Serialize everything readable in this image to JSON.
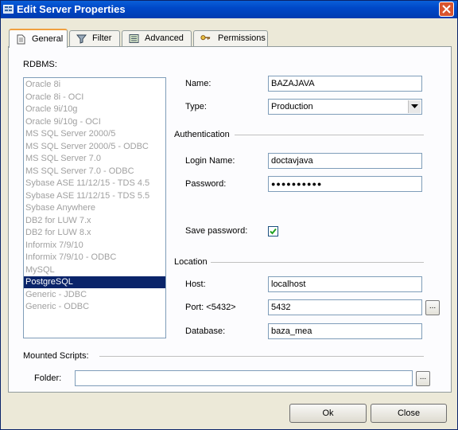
{
  "window": {
    "title": "Edit Server Properties"
  },
  "tabs": [
    {
      "label": "General",
      "icon": "page-icon",
      "active": true
    },
    {
      "label": "Filter",
      "icon": "filter-icon",
      "active": false
    },
    {
      "label": "Advanced",
      "icon": "advanced-icon",
      "active": false
    },
    {
      "label": "Permissions",
      "icon": "keys-icon",
      "active": false
    }
  ],
  "rdbms": {
    "label": "RDBMS:",
    "items": [
      "Oracle 8i",
      "Oracle 8i - OCI",
      "Oracle 9i/10g",
      "Oracle 9i/10g - OCI",
      "MS SQL Server 2000/5",
      "MS SQL Server 2000/5 - ODBC",
      "MS SQL Server 7.0",
      "MS SQL Server 7.0 - ODBC",
      "Sybase ASE 11/12/15 - TDS 4.5",
      "Sybase ASE 11/12/15 - TDS 5.5",
      "Sybase Anywhere",
      "DB2 for LUW 7.x",
      "DB2 for LUW 8.x",
      "Informix 7/9/10",
      "Informix 7/9/10 - ODBC",
      "MySQL",
      "PostgreSQL",
      "Generic - JDBC",
      "Generic - ODBC"
    ],
    "selected": "PostgreSQL"
  },
  "form": {
    "name_label": "Name:",
    "name_value": "BAZAJAVA",
    "type_label": "Type:",
    "type_value": "Production",
    "auth_section": "Authentication",
    "login_label": "Login Name:",
    "login_value": "doctavjava",
    "password_label": "Password:",
    "password_value": "●●●●●●●●●●",
    "save_password_label": "Save password:",
    "save_password_checked": true,
    "location_section": "Location",
    "host_label": "Host:",
    "host_value": "localhost",
    "port_label": "Port: <5432>",
    "port_value": "5432",
    "database_label": "Database:",
    "database_value": "baza_mea"
  },
  "mounted": {
    "section": "Mounted Scripts:",
    "folder_label": "Folder:",
    "folder_value": "",
    "browse_label": "..."
  },
  "buttons": {
    "ok": "Ok",
    "close": "Close"
  },
  "colors": {
    "title_bar": "#0048c8",
    "selection": "#0a246a",
    "close_button": "#d9542e",
    "tab_highlight": "#f0a040"
  }
}
